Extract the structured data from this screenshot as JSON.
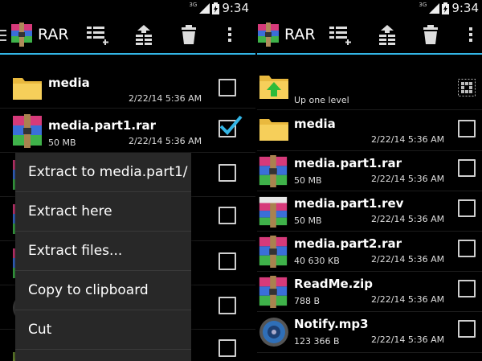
{
  "colors": {
    "accent": "#33b5e5",
    "check": "#33b5e5",
    "folder": "#f2c545"
  },
  "status": {
    "network": "3G",
    "time": "9:34"
  },
  "app": {
    "title": "RAR"
  },
  "icons": [
    "rar-app-icon",
    "select-all-icon",
    "extract-icon",
    "delete-icon",
    "overflow-menu-icon"
  ],
  "left": {
    "files": [
      {
        "name": "media",
        "size": "",
        "date": "2/22/14 5:36 AM",
        "type": "folder",
        "checked": false
      },
      {
        "name": "media.part1.rar",
        "size": "50 MB",
        "date": "2/22/14 5:36 AM",
        "type": "rar",
        "checked": true
      }
    ],
    "menu": [
      "Extract to media.part1/",
      "Extract here",
      "Extract files...",
      "Copy to clipboard",
      "Cut"
    ]
  },
  "right": {
    "up": "Up one level",
    "files": [
      {
        "name": "media",
        "size": "",
        "date": "2/22/14 5:36 AM",
        "type": "folder"
      },
      {
        "name": "media.part1.rar",
        "size": "50 MB",
        "date": "2/22/14 5:36 AM",
        "type": "rar"
      },
      {
        "name": "media.part1.rev",
        "size": "50 MB",
        "date": "2/22/14 5:36 AM",
        "type": "rev"
      },
      {
        "name": "media.part2.rar",
        "size": "40 630 KB",
        "date": "2/22/14 5:36 AM",
        "type": "rar"
      },
      {
        "name": "ReadMe.zip",
        "size": "788 B",
        "date": "2/22/14 5:36 AM",
        "type": "rar"
      },
      {
        "name": "Notify.mp3",
        "size": "123 366 B",
        "date": "2/22/14 5:36 AM",
        "type": "audio"
      }
    ]
  }
}
